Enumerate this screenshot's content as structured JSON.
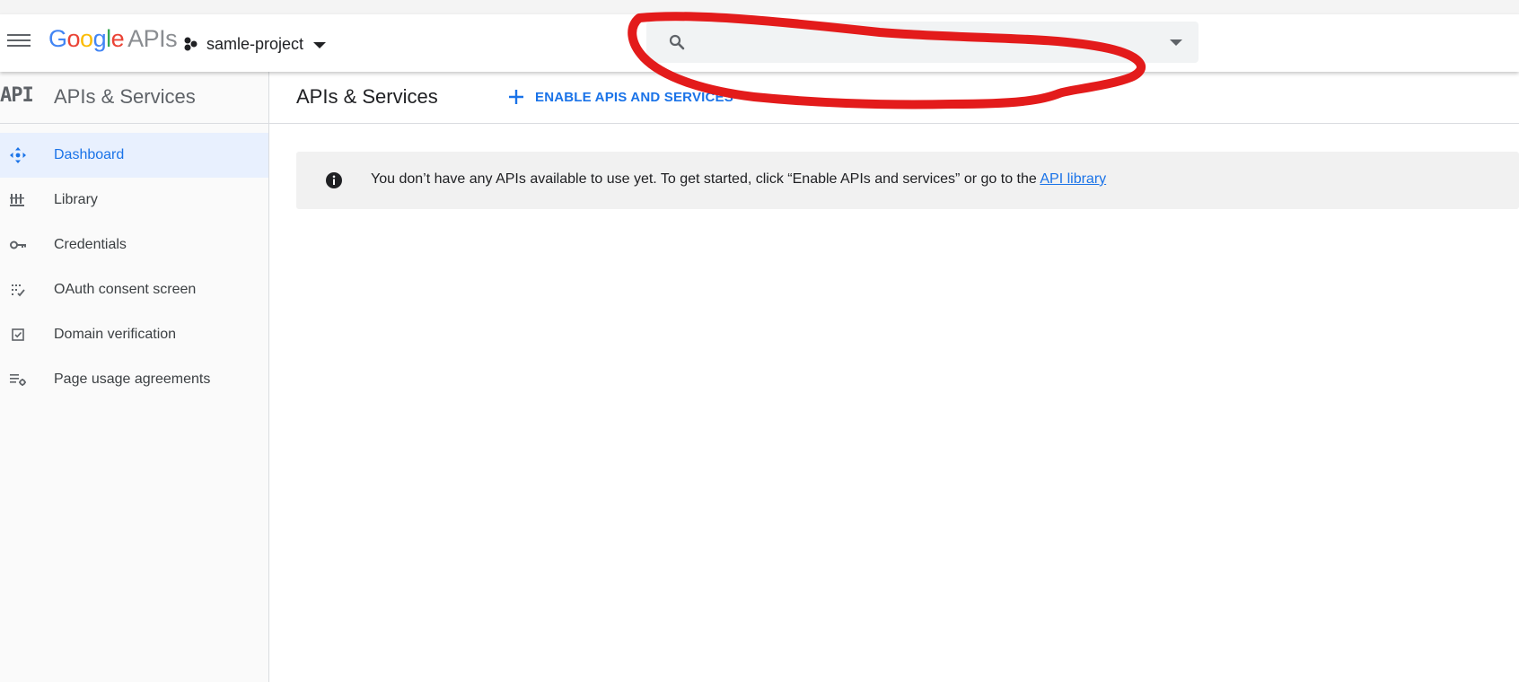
{
  "header": {
    "logo": {
      "google": "Google",
      "apis": "APIs"
    },
    "project_name": "samle-project",
    "search_placeholder": ""
  },
  "sidebar": {
    "badge": "API",
    "title": "APIs & Services",
    "items": [
      {
        "label": "Dashboard",
        "icon": "dashboard-icon",
        "active": true
      },
      {
        "label": "Library",
        "icon": "library-icon",
        "active": false
      },
      {
        "label": "Credentials",
        "icon": "key-icon",
        "active": false
      },
      {
        "label": "OAuth consent screen",
        "icon": "oauth-consent-icon",
        "active": false
      },
      {
        "label": "Domain verification",
        "icon": "checkbox-icon",
        "active": false
      },
      {
        "label": "Page usage agreements",
        "icon": "settings-list-icon",
        "active": false
      }
    ]
  },
  "main": {
    "title": "APIs & Services",
    "enable_button": "ENABLE APIS AND SERVICES",
    "banner": {
      "text": "You don’t have any APIs available to use yet. To get started, click “Enable APIs and services” or go to the ",
      "link": "API library"
    }
  },
  "colors": {
    "accent": "#1a73e8",
    "active_nav_bg": "#e8f0fe",
    "annotation": "#e31b1b"
  }
}
